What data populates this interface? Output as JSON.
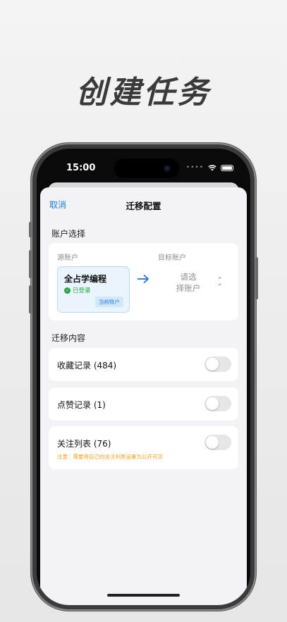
{
  "headline": "创建任务",
  "status_bar": {
    "time": "15:00",
    "signal": "••••"
  },
  "nav": {
    "cancel": "取消",
    "title": "迁移配置"
  },
  "account_section": {
    "title": "账户选择",
    "source_label": "源账户",
    "target_label": "目标账户",
    "source_account": {
      "name": "全占学编程",
      "status": "已登录",
      "badge": "当前账户"
    },
    "target_placeholder_line1": "请选",
    "target_placeholder_line2": "择账户"
  },
  "content_section": {
    "title": "迁移内容",
    "items": [
      {
        "label": "收藏记录 (484)",
        "enabled": false
      },
      {
        "label": "点赞记录 (1)",
        "enabled": false
      },
      {
        "label": "关注列表 (76)",
        "enabled": false,
        "note": "注意：需要将自己的关注列表设置为公开可见"
      }
    ]
  },
  "colors": {
    "accent": "#1e7ad6",
    "success": "#2aa248",
    "warning": "#f0a020"
  }
}
